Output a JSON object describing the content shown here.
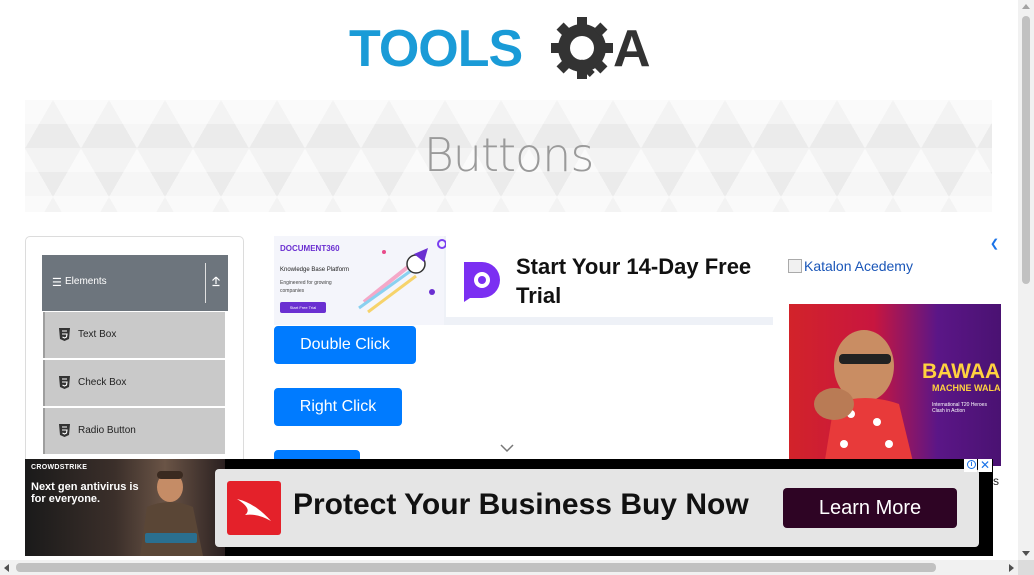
{
  "logo": {
    "text_tools": "TOOLS",
    "text_qa": "QA",
    "colors": {
      "tools": "#1a9bd7",
      "qa": "#333333"
    }
  },
  "banner": {
    "title": "Buttons"
  },
  "sidebar": {
    "group": {
      "icon": "hamburger-icon",
      "label": "Elements",
      "toggle_icon": "collapse-up-icon"
    },
    "items": [
      {
        "icon": "html5-icon",
        "label": "Text Box"
      },
      {
        "icon": "html5-icon",
        "label": "Check Box"
      },
      {
        "icon": "html5-icon",
        "label": "Radio Button"
      }
    ]
  },
  "ad_top": {
    "doc_brand": "DOCUMENT360",
    "doc_kb": "Knowledge Base Platform",
    "doc_engineered": "Engineered for growing companies",
    "doc_cta": "Start Free Trial",
    "trial_text": "Start Your 14-Day Free Trial",
    "accent": "#6a2fd1"
  },
  "buttons": {
    "double_click": "Double Click Me",
    "right_click": "Right Click Me",
    "click": ""
  },
  "ad_right": {
    "image_alt": "Katalon Acedemy",
    "ipl_headline": "BAWAAL",
    "ipl_sub": "MACHNE WALA",
    "ipl_line": "International T20 Heroes Clash in Action"
  },
  "ad_bottom": {
    "brand": "CROWDSTRIKE",
    "tagline": "Next gen antivirus is for everyone.",
    "headline": "Protect Your Business Buy Now",
    "cta": "Learn More",
    "info_icon": "info-icon",
    "close_icon": "close-icon",
    "cta_color": "#2e0424",
    "logo_color": "#e4212a"
  },
  "under_text": "s"
}
